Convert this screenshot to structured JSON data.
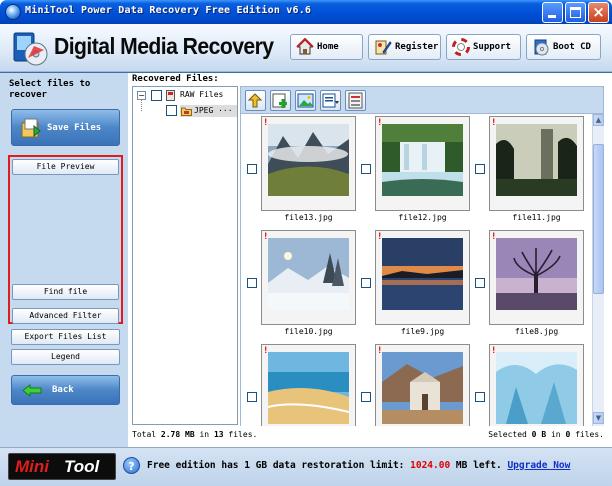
{
  "window": {
    "title": "MiniTool Power Data Recovery Free Edition v6.6"
  },
  "header": {
    "app_title": "Digital Media Recovery",
    "buttons": {
      "home": "Home",
      "register": "Register",
      "support": "Support",
      "boot_cd": "Boot CD"
    }
  },
  "left_panel": {
    "caption": "Select files to recover",
    "save_files": "Save Files",
    "file_preview": "File Preview",
    "find_file": "Find file",
    "advanced_filter": "Advanced Filter",
    "export_files_list": "Export Files List",
    "legend": "Legend",
    "back": "Back"
  },
  "content": {
    "recovered_label": "Recovered Files:",
    "tree": [
      {
        "label": "RAW Files",
        "expanded": true
      },
      {
        "label": "JPEG ···",
        "selected": true
      }
    ],
    "files": [
      {
        "name": "file13.jpg",
        "thumb": "mountain-valley-clouds"
      },
      {
        "name": "file12.jpg",
        "thumb": "waterfall"
      },
      {
        "name": "file11.jpg",
        "thumb": "foggy-forest"
      },
      {
        "name": "file10.jpg",
        "thumb": "snowy-trees"
      },
      {
        "name": "file9.jpg",
        "thumb": "lake-sunset"
      },
      {
        "name": "file8.jpg",
        "thumb": "tree-purple-sky"
      },
      {
        "name": "",
        "thumb": "beach"
      },
      {
        "name": "",
        "thumb": "desert-church"
      },
      {
        "name": "",
        "thumb": "ice-cave"
      }
    ],
    "status": {
      "total_prefix": "Total",
      "total_size": "2.78",
      "total_unit": "MB",
      "in_text": "in",
      "total_count": "13",
      "files_word": "files.",
      "selected_prefix": "Selected",
      "selected_size": "0",
      "selected_unit": "B",
      "selected_count": "0"
    }
  },
  "footer": {
    "brand_mini": "Mini",
    "brand_tool": "Tool",
    "message_pre": "Free edition has 1 GB data restoration limit:",
    "limit_value": "1024.00",
    "limit_unit": "MB",
    "message_post": "left.",
    "upgrade_link": "Upgrade Now"
  },
  "colors": {
    "accent": "#0050d8",
    "panel": "#c5d9ef",
    "highlight_box": "#e21b1b",
    "limit_text": "#e00000",
    "link": "#1030c8"
  }
}
